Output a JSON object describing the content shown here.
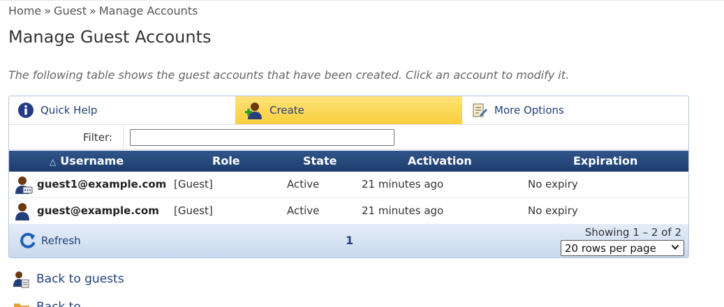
{
  "breadcrumb": {
    "items": [
      "Home",
      "Guest",
      "Manage Accounts"
    ],
    "separator": "»"
  },
  "page": {
    "title": "Manage Guest Accounts",
    "description": "The following table shows the guest accounts that have been created. Click an account to modify it."
  },
  "toolbar": {
    "quick_help_label": "Quick Help",
    "create_label": "Create",
    "more_options_label": "More Options",
    "quick_help_icon": "info-icon",
    "create_icon": "add-user-icon",
    "more_options_icon": "edit-list-icon"
  },
  "filter": {
    "label": "Filter:",
    "value": ""
  },
  "table": {
    "sort_indicator": "△",
    "columns": [
      "Username",
      "Role",
      "State",
      "Activation",
      "Expiration"
    ],
    "rows": [
      {
        "username": "guest1@example.com",
        "role": "[Guest]",
        "state": "Active",
        "activation": "21 minutes ago",
        "expiration": "No expiry"
      },
      {
        "username": "guest@example.com",
        "role": "[Guest]",
        "state": "Active",
        "activation": "21 minutes ago",
        "expiration": "No expiry"
      }
    ]
  },
  "footer": {
    "refresh_label": "Refresh",
    "page_number": "1",
    "showing_text": "Showing 1 – 2 of 2",
    "rows_per_page": "20 rows per page"
  },
  "links": {
    "back_to_guests": "Back to guests",
    "second_link": "Back to ..."
  },
  "colors": {
    "header_bg": "#1d3e6e",
    "create_highlight": "#f9cf3c",
    "link": "#1f3f7a",
    "footer_bg": "#c9d9ee"
  }
}
